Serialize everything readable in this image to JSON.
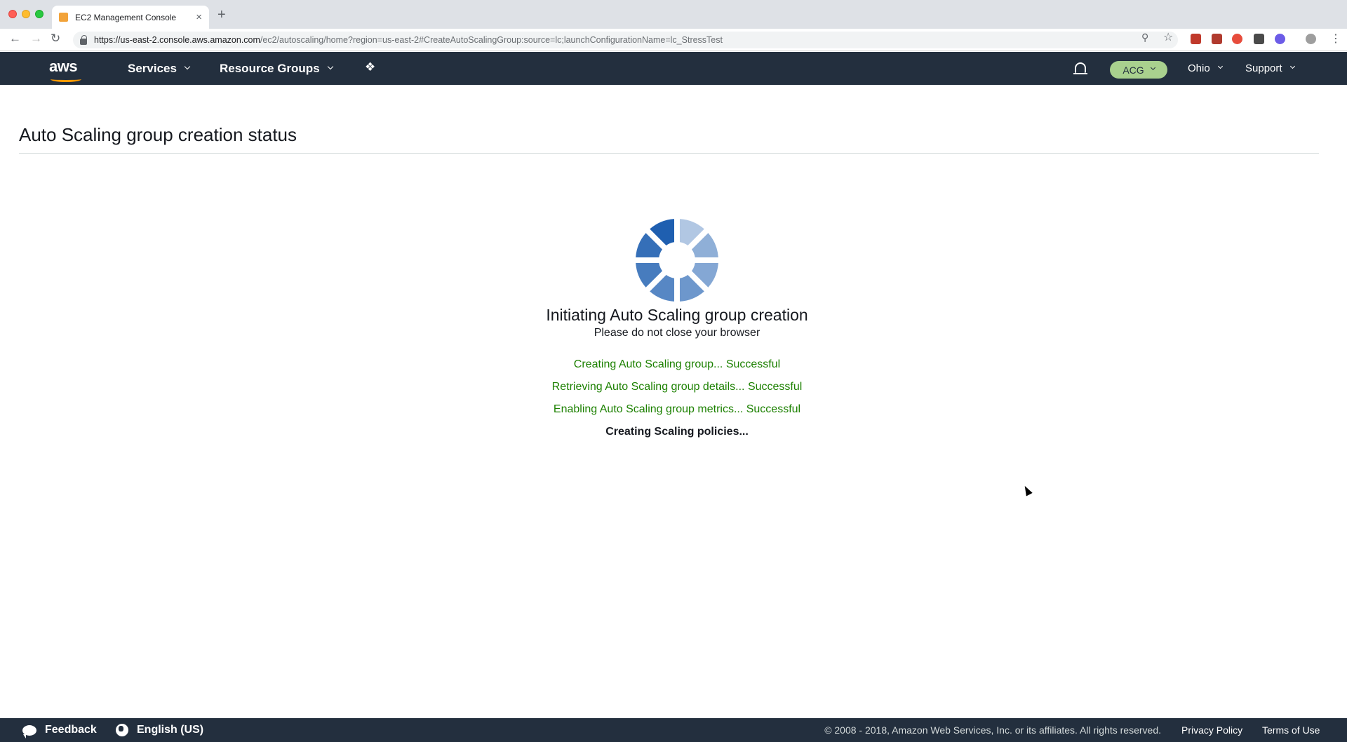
{
  "browser": {
    "tab_title": "EC2 Management Console",
    "tab_close": "×",
    "new_tab": "+",
    "url_host": "https://us-east-2.console.aws.amazon.com",
    "url_path": "/ec2/autoscaling/home?region=us-east-2#CreateAutoScalingGroup:source=lc;launchConfigurationName=lc_StressTest"
  },
  "navbar": {
    "logo": "aws",
    "services": "Services",
    "resource_groups": "Resource Groups",
    "account": "ACG",
    "region": "Ohio",
    "support": "Support"
  },
  "page": {
    "title": "Auto Scaling group creation status",
    "heading": "Initiating Auto Scaling group creation",
    "subheading": "Please do not close your browser",
    "steps": [
      {
        "text": "Creating Auto Scaling group... Successful"
      },
      {
        "text": "Retrieving Auto Scaling group details... Successful"
      },
      {
        "text": "Enabling Auto Scaling group metrics... Successful"
      },
      {
        "text": "Creating Scaling policies..."
      }
    ]
  },
  "footer": {
    "feedback": "Feedback",
    "language": "English (US)",
    "copyright": "© 2008 - 2018, Amazon Web Services, Inc. or its affiliates. All rights reserved.",
    "privacy": "Privacy Policy",
    "terms": "Terms of Use"
  },
  "colors": {
    "nav_bg": "#232f3e",
    "success": "#1d8102",
    "account_badge": "#a9d18e",
    "spinner": "#1f5fb0"
  }
}
